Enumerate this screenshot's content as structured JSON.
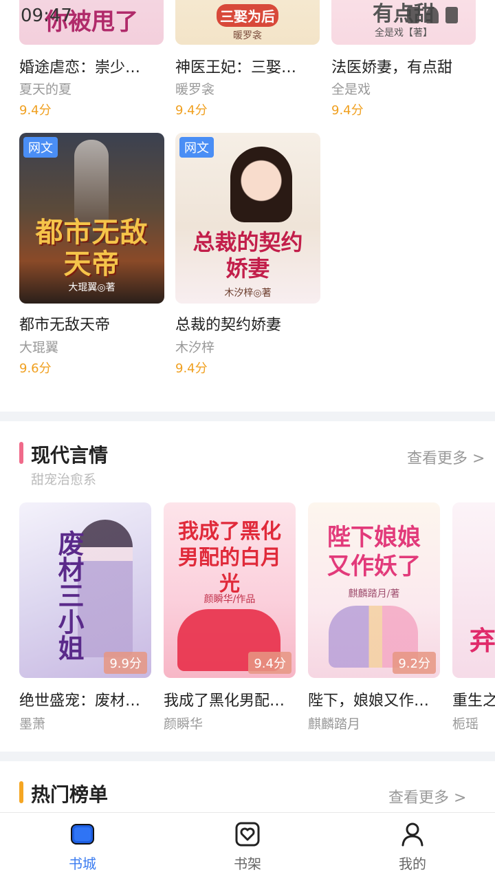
{
  "status_bar": {
    "time": "09:47"
  },
  "top_books": [
    {
      "title": "婚途虐恋：崇少…",
      "author": "夏天的夏",
      "score": "9.4分",
      "cover_title": "你被甩了"
    },
    {
      "title": "神医王妃：三娶…",
      "author": "暖罗衾",
      "score": "9.4分",
      "cover_title": "三娶为后",
      "cover_author": "暖罗衾"
    },
    {
      "title": "法医娇妻，有点甜",
      "author": "全是戏",
      "score": "9.4分",
      "cover_title": "有点甜",
      "cover_author": "全是戏【著】"
    }
  ],
  "second_books": [
    {
      "title": "都市无敌天帝",
      "author": "大琨翼",
      "score": "9.6分",
      "tag": "网文",
      "cover_title": "都市无敌天帝",
      "cover_author": "大琨翼◎著"
    },
    {
      "title": "总裁的契约娇妻",
      "author": "木汐梓",
      "score": "9.4分",
      "tag": "网文",
      "cover_title": "总裁的契约娇妻",
      "cover_author": "木汐梓◎著"
    }
  ],
  "section_modern": {
    "title": "现代言情",
    "subtitle": "甜宠治愈系",
    "more": "查看更多 >",
    "accent": "#f06a8a",
    "books": [
      {
        "title": "绝世盛宠：废材…",
        "author": "墨萧",
        "score": "9.9分",
        "cover_title": "废材三小姐"
      },
      {
        "title": "我成了黑化男配…",
        "author": "颜瞬华",
        "score": "9.4分",
        "cover_title": "我成了黑化男配的白月光",
        "cover_author": "颜瞬华/作品"
      },
      {
        "title": "陛下，娘娘又作…",
        "author": "麒麟踏月",
        "score": "9.2分",
        "cover_title": "陛下娘娘又作妖了",
        "cover_author": "麒麟踏月/著"
      },
      {
        "title": "重生之…",
        "author": "栀瑶",
        "cover_title": "弃"
      }
    ]
  },
  "section_hot": {
    "title": "热门榜单",
    "more": "查看更多 >",
    "accent": "#f5a623"
  },
  "tab_bar": [
    {
      "label": "书城",
      "icon": "bookstore-icon",
      "active": true
    },
    {
      "label": "书架",
      "icon": "bookshelf-icon",
      "active": false
    },
    {
      "label": "我的",
      "icon": "profile-icon",
      "active": false
    }
  ]
}
